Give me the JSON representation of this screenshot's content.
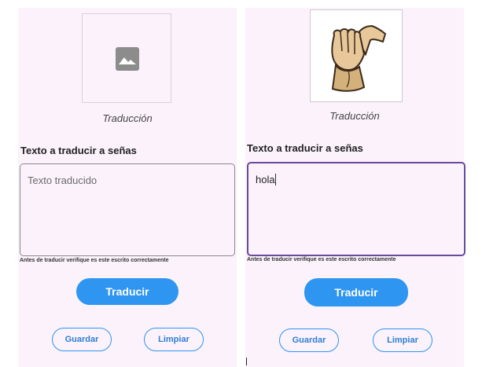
{
  "left_panel": {
    "caption": "Traducción",
    "section_title": "Texto a traducir a señas",
    "textarea_placeholder": "Texto traducido",
    "hint": "Antes de traducir verifique es este escrito correctamente",
    "translate_button": "Traducir",
    "save_button": "Guardar",
    "clear_button": "Limpiar",
    "image": "image-placeholder-icon"
  },
  "right_panel": {
    "caption": "Traducción",
    "section_title": "Texto a traducir a señas",
    "textarea_value": "hola",
    "hint": "Antes de traducir verifique es este escrito correctamente",
    "translate_button": "Traducir",
    "save_button": "Guardar",
    "clear_button": "Limpiar",
    "image": "hand-sign-image"
  },
  "colors": {
    "background": "#fbf2fb",
    "primary": "#2e95f0",
    "focus_border": "#6a4a9c"
  }
}
